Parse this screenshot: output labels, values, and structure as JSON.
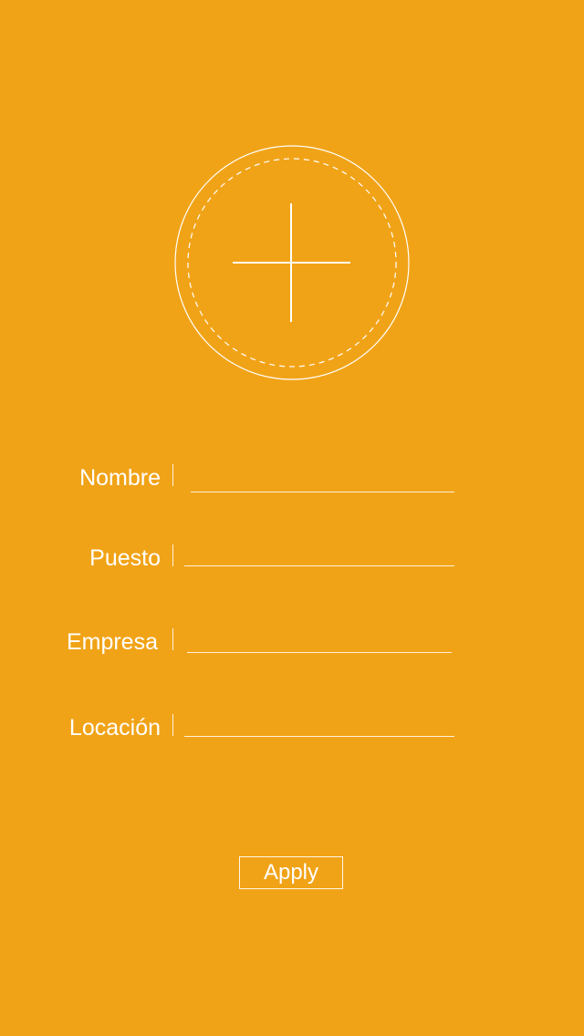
{
  "theme": {
    "background_color": "#F1A317",
    "foreground_color": "#FFFFFF"
  },
  "avatar": {
    "icon": "add-photo-plus-icon"
  },
  "form": {
    "fields": [
      {
        "label": "Nombre",
        "value": ""
      },
      {
        "label": "Puesto",
        "value": ""
      },
      {
        "label": "Empresa",
        "value": ""
      },
      {
        "label": "Locación",
        "value": ""
      }
    ]
  },
  "actions": {
    "apply_label": "Apply"
  }
}
